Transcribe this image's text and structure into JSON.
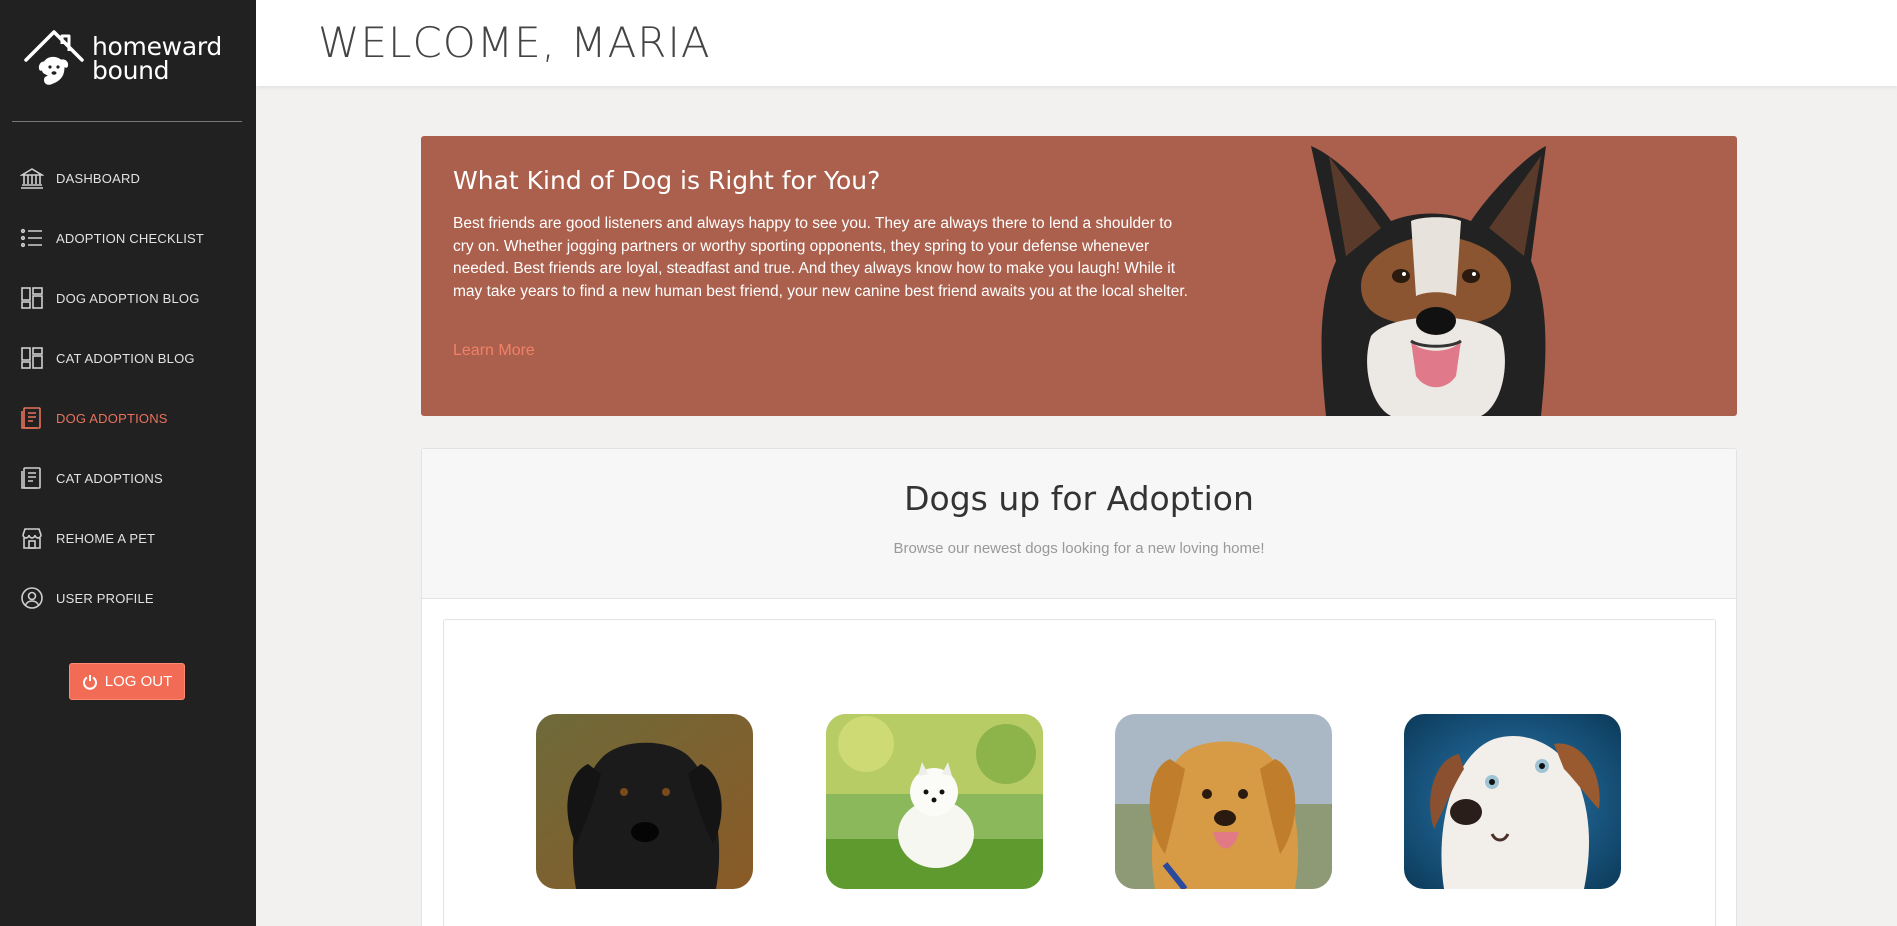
{
  "brand": {
    "line1": "homeward",
    "line2": "bound"
  },
  "header": {
    "welcome": "WELCOME, MARIA"
  },
  "sidebar": {
    "items": [
      {
        "label": "DASHBOARD",
        "icon": "bank-icon",
        "active": false
      },
      {
        "label": "ADOPTION CHECKLIST",
        "icon": "list-icon",
        "active": false
      },
      {
        "label": "DOG ADOPTION BLOG",
        "icon": "dashboard-grid-icon",
        "active": false
      },
      {
        "label": "CAT ADOPTION BLOG",
        "icon": "dashboard-grid-icon",
        "active": false
      },
      {
        "label": "DOG ADOPTIONS",
        "icon": "document-icon",
        "active": true
      },
      {
        "label": "CAT ADOPTIONS",
        "icon": "document-icon",
        "active": false
      },
      {
        "label": "REHOME A PET",
        "icon": "shop-icon",
        "active": false
      },
      {
        "label": "USER PROFILE",
        "icon": "user-circle-icon",
        "active": false
      }
    ],
    "logout_label": "LOG OUT"
  },
  "hero": {
    "title": "What Kind of Dog is Right for You?",
    "body": "Best friends are good listeners and always happy to see you. They are always there to lend a shoulder to cry on. Whether jogging partners or worthy sporting opponents, they spring to your defense whenever needed. Best friends are loyal, steadfast and true. And they always know how to make you laugh! While it may take years to find a new human best friend, your new canine best friend awaits you at the local shelter.",
    "link": "Learn More"
  },
  "adoptions": {
    "title": "Dogs up for Adoption",
    "subtitle": "Browse our newest dogs looking for a new loving home!"
  },
  "colors": {
    "sidebar_bg": "#212121",
    "accent": "#f26c55",
    "hero_bg": "#ab604d",
    "page_bg": "#f2f1ef"
  }
}
